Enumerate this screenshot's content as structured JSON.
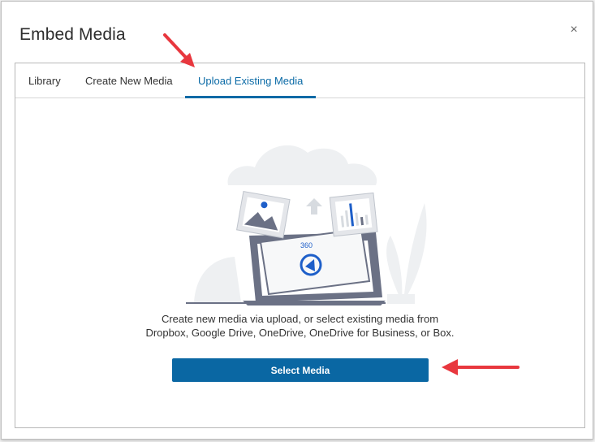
{
  "dialog": {
    "title": "Embed Media",
    "close_label": "×"
  },
  "tabs": [
    {
      "label": "Library",
      "active": false
    },
    {
      "label": "Create New Media",
      "active": false
    },
    {
      "label": "Upload Existing Media",
      "active": true
    }
  ],
  "illustration": {
    "badge_360": "360"
  },
  "upload": {
    "description_line1": "Create new media via upload, or select existing media from",
    "description_line2": "Dropbox, Google Drive, OneDrive, OneDrive for Business, or Box.",
    "select_button": "Select Media"
  },
  "colors": {
    "accent": "#0a6aa6",
    "button": "#0a67a3",
    "annotation_arrow": "#e8373e"
  }
}
